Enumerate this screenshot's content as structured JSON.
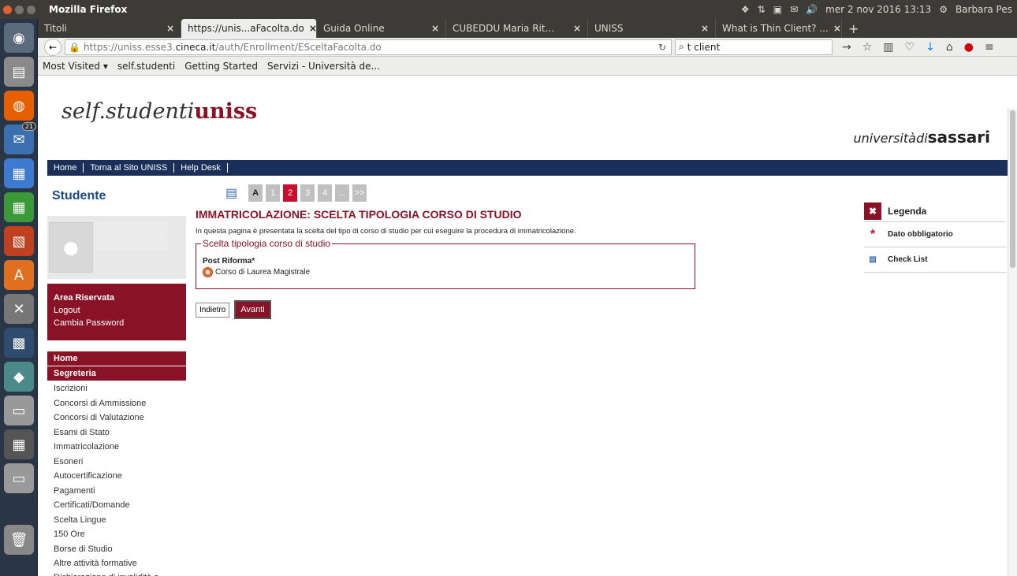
{
  "os": {
    "app": "Mozilla Firefox",
    "datetime": "mer 2 nov 2016 13:13",
    "user": "Barbara Pes",
    "launcher_badge": "21"
  },
  "tabs": [
    {
      "label": "Titoli",
      "active": false
    },
    {
      "label": "https://unis...aFacolta.do",
      "active": true
    },
    {
      "label": "Guida Online",
      "active": false
    },
    {
      "label": "CUBEDDU Maria Rit...",
      "active": false
    },
    {
      "label": "UNISS",
      "active": false
    },
    {
      "label": "What is Thin Client? ...",
      "active": false
    }
  ],
  "nav": {
    "url_prefix": "https://uniss.esse3.",
    "url_domain": "cineca.it",
    "url_suffix": "/auth/Enrollment/ESceltaFacolta.do",
    "search": "t client"
  },
  "bookmarks": [
    "Most Visited ▾",
    "self.studenti",
    "Getting Started",
    "Servizi - Università de..."
  ],
  "site": {
    "logo_a": "self.studenti",
    "logo_b": "uniss",
    "uni_a": "università",
    "uni_b": "di",
    "uni_c": "sassari",
    "topnav": [
      "Home",
      "Torna al Sito UNISS",
      "Help Desk"
    ]
  },
  "sidebar": {
    "title": "Studente",
    "area_title": "Area Riservata",
    "area_links": [
      "Logout",
      "Cambia Password"
    ],
    "menu_home": "Home",
    "menu_seg": "Segreteria",
    "items": [
      "Iscrizioni",
      "Concorsi di Ammissione",
      "Concorsi di Valutazione",
      "Esami di Stato",
      "Immatricolazione",
      "Esoneri",
      "Autocertificazione",
      "Pagamenti",
      "Certificati/Domande",
      "Scelta Lingue",
      "150 Ore",
      "Borse di Studio",
      "Altre attività formative",
      "Dichiarazione di invalidità o disturbi specifici dell'apprendimento"
    ]
  },
  "main": {
    "steps": [
      "A",
      "1",
      "2",
      "3",
      "4",
      "...",
      ">>"
    ],
    "current_step": "2",
    "title": "IMMATRICOLAZIONE: SCELTA TIPOLOGIA CORSO DI STUDIO",
    "desc": "In questa pagina è presentata la scelta del tipo di corso di studio per cui eseguire la procedura di immatricolazione.",
    "fieldset": "Scelta tipologia corso di studio",
    "group": "Post Riforma*",
    "option": "Corso di Laurea Magistrale",
    "back": "Indietro",
    "next": "Avanti"
  },
  "legend": {
    "title": "Legenda",
    "item1": "Dato obbligatorio",
    "item2": "Check List"
  },
  "colors": {
    "accent": "#8a1226",
    "nav": "#1a2f5a",
    "step_current": "#c8102e"
  }
}
